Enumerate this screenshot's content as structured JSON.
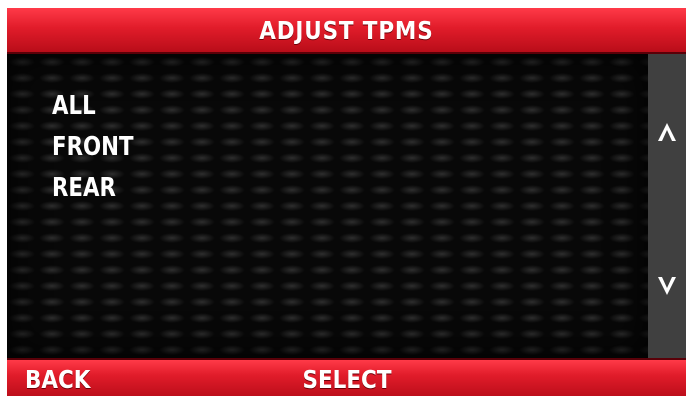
{
  "header": {
    "title": "ADJUST TPMS"
  },
  "menu": {
    "items": [
      {
        "label": "ALL"
      },
      {
        "label": "FRONT"
      },
      {
        "label": "REAR"
      }
    ]
  },
  "scroll": {
    "up_icon": "arrow-up-icon",
    "down_icon": "arrow-down-icon"
  },
  "footer": {
    "back_label": "BACK",
    "select_label": "SELECT"
  },
  "colors": {
    "accent_red": "#e11c2a",
    "panel_gray": "#404040",
    "text": "#ffffff"
  }
}
